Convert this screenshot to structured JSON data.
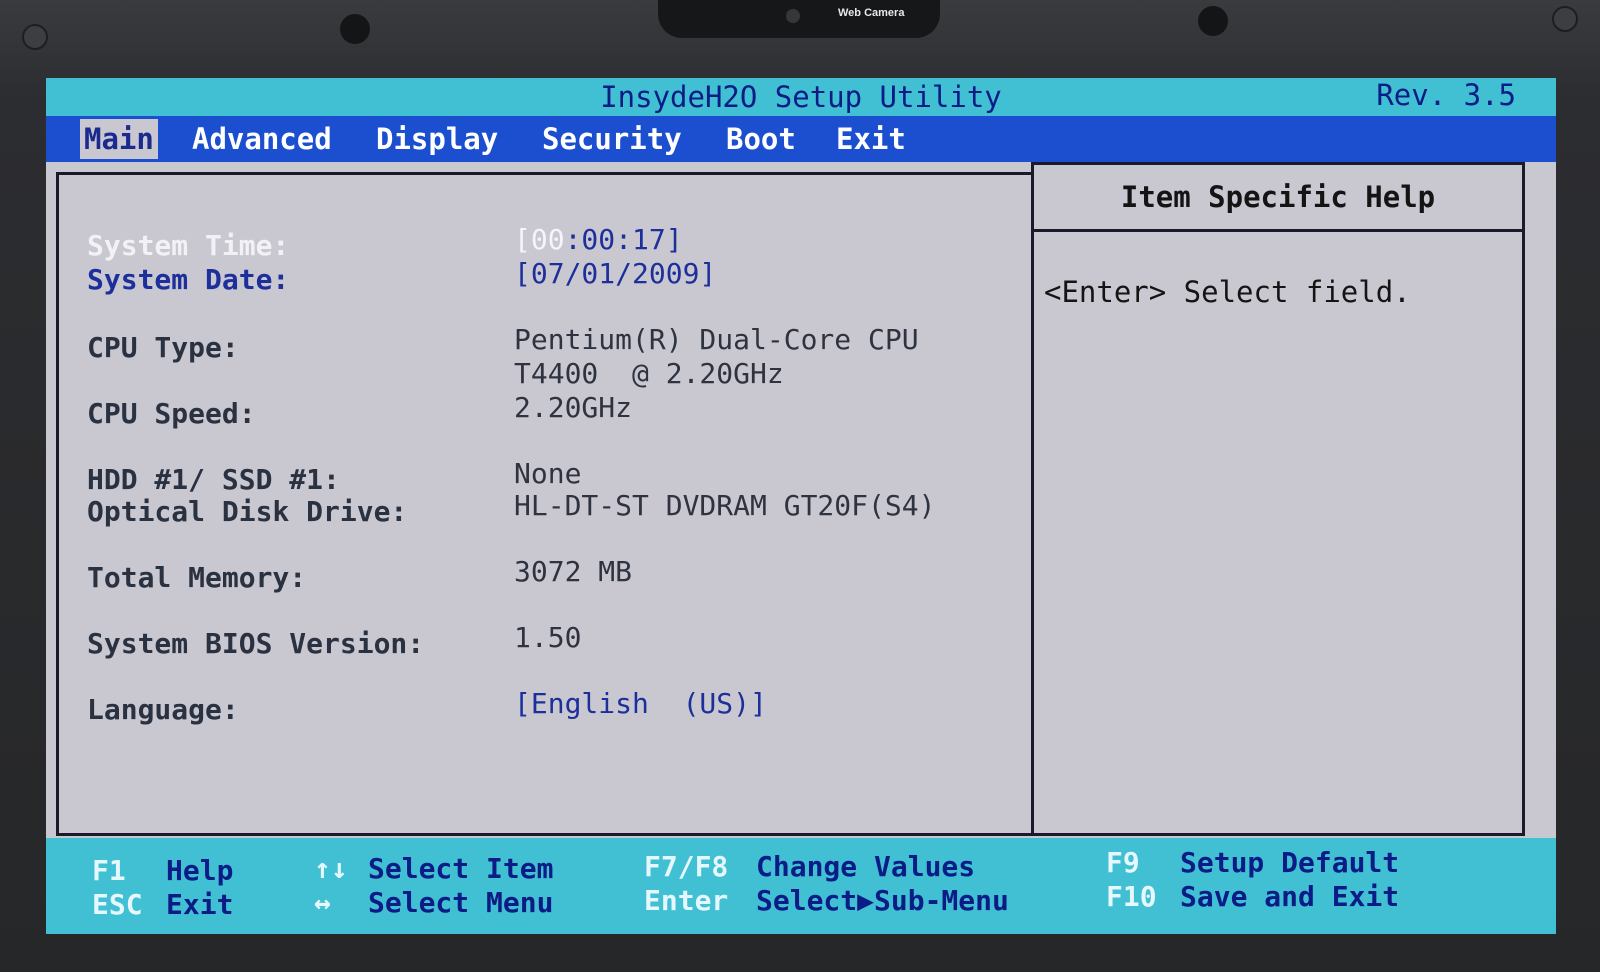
{
  "bezel": {
    "camera_label": "Web Camera"
  },
  "title": "InsydeH2O Setup Utility",
  "revision": "Rev. 3.5",
  "menu": [
    "Main",
    "Advanced",
    "Display",
    "Security",
    "Boot",
    "Exit"
  ],
  "fields": {
    "system_time": {
      "label": "System Time:",
      "value_selected": "[00",
      "value_rest": ":00:17]"
    },
    "system_date": {
      "label": "System Date:",
      "value": "[07/01/2009]"
    },
    "cpu_type": {
      "label": "CPU Type:",
      "value_line1": "Pentium(R) Dual-Core CPU",
      "value_line2": "T4400  @ 2.20GHz"
    },
    "cpu_speed": {
      "label": "CPU Speed:",
      "value": "2.20GHz"
    },
    "hdd": {
      "label": "HDD #1/ SSD #1:",
      "value": "None"
    },
    "optical": {
      "label": "Optical Disk Drive:",
      "value": "HL-DT-ST DVDRAM GT20F(S4)"
    },
    "memory": {
      "label": "Total Memory:",
      "value": "3072 MB"
    },
    "bios": {
      "label": "System BIOS Version:",
      "value": "1.50"
    },
    "language": {
      "label": "Language:",
      "value": "[English  (US)]"
    }
  },
  "help": {
    "title": "Item Specific Help",
    "text": "<Enter> Select field."
  },
  "footer": {
    "f1_key": "F1",
    "f1_desc": "Help",
    "esc_key": "ESC",
    "esc_desc": "Exit",
    "updown_key": "↑↓",
    "updown_desc": "Select Item",
    "leftright_key": "↔",
    "leftright_desc": "Select Menu",
    "f7f8_key": "F7/F8",
    "f7f8_desc": "Change Values",
    "enter_key": "Enter",
    "enter_desc": "Select▶Sub-Menu",
    "f9_key": "F9",
    "f9_desc": "Setup Default",
    "f10_key": "F10",
    "f10_desc": "Save and Exit"
  },
  "colors": {
    "title_bar": "#41bfd3",
    "menu_bar": "#1c4fcf",
    "panel": "#c9c8d1",
    "highlight_text": "#1d2f9a"
  }
}
